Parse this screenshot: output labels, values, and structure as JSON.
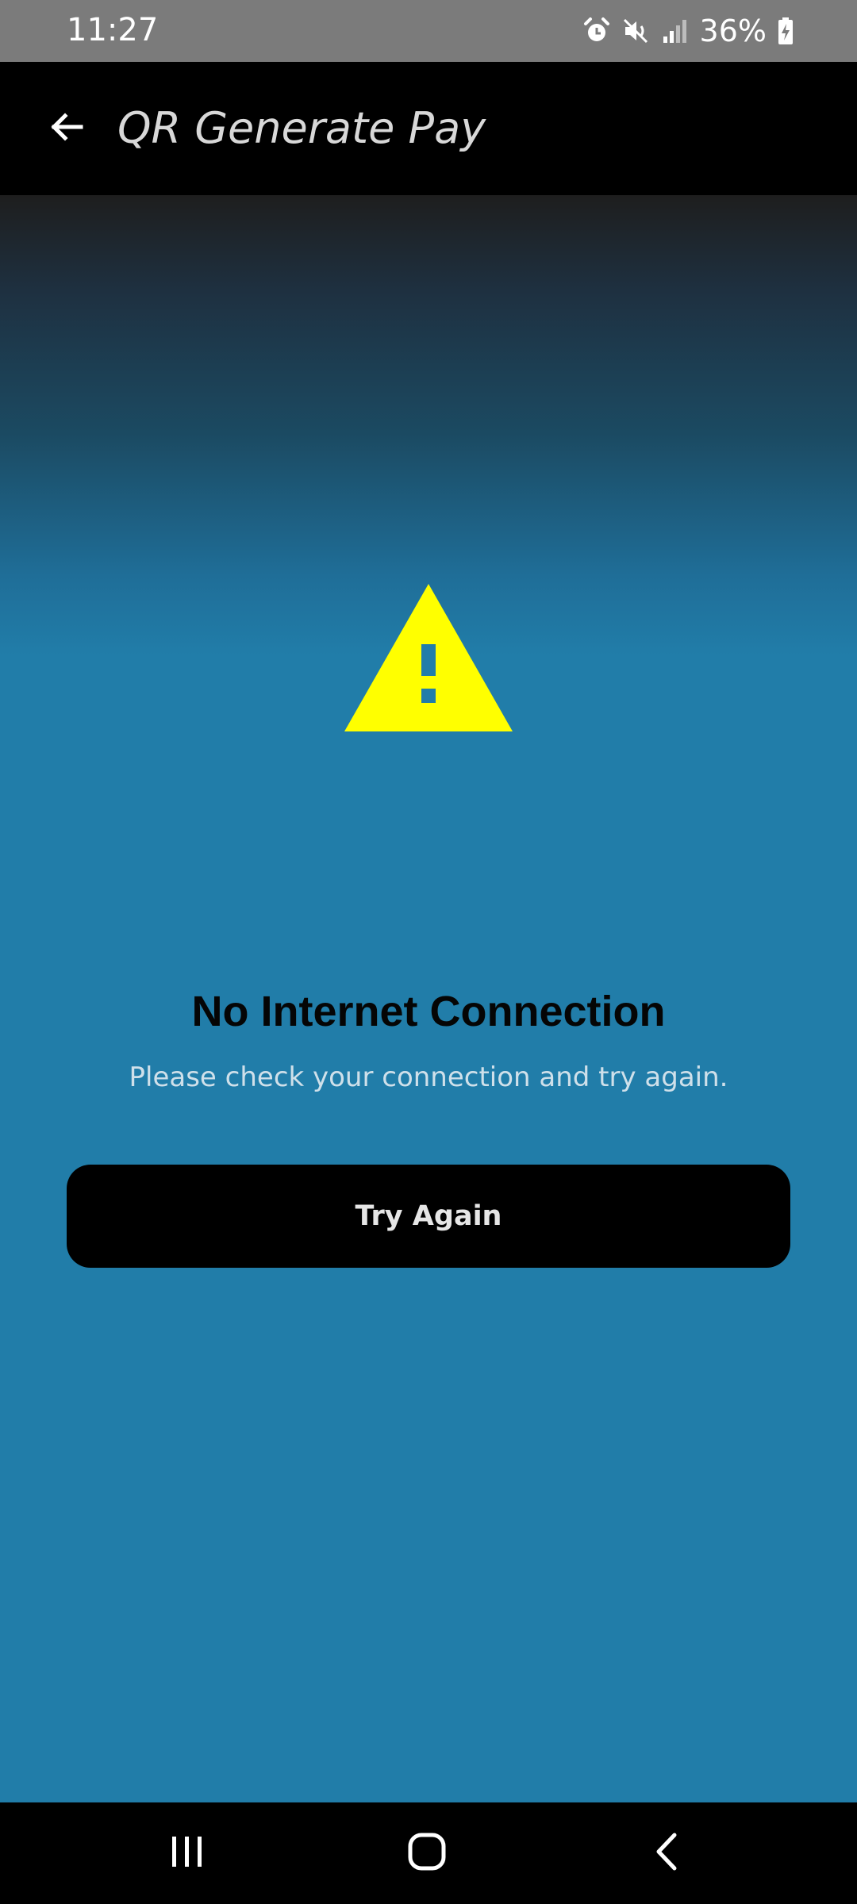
{
  "status_bar": {
    "time": "11:27",
    "battery_percent": "36%",
    "icons": [
      "alarm-icon",
      "mute-icon",
      "signal-icon",
      "battery-charging-icon"
    ]
  },
  "app_bar": {
    "title": "QR Generate Pay",
    "back_icon": "arrow-left-icon"
  },
  "error": {
    "icon": "warning-triangle-icon",
    "icon_color": "#FFFF00",
    "title": "No Internet Connection",
    "message": "Please check your connection and try again.",
    "retry_label": "Try Again"
  },
  "colors": {
    "background": "#217DA9",
    "app_bar": "#000000",
    "status_bar": "#7B7B7B",
    "button": "#000000"
  },
  "nav_bar": {
    "buttons": [
      "recents-icon",
      "home-icon",
      "back-icon"
    ]
  }
}
